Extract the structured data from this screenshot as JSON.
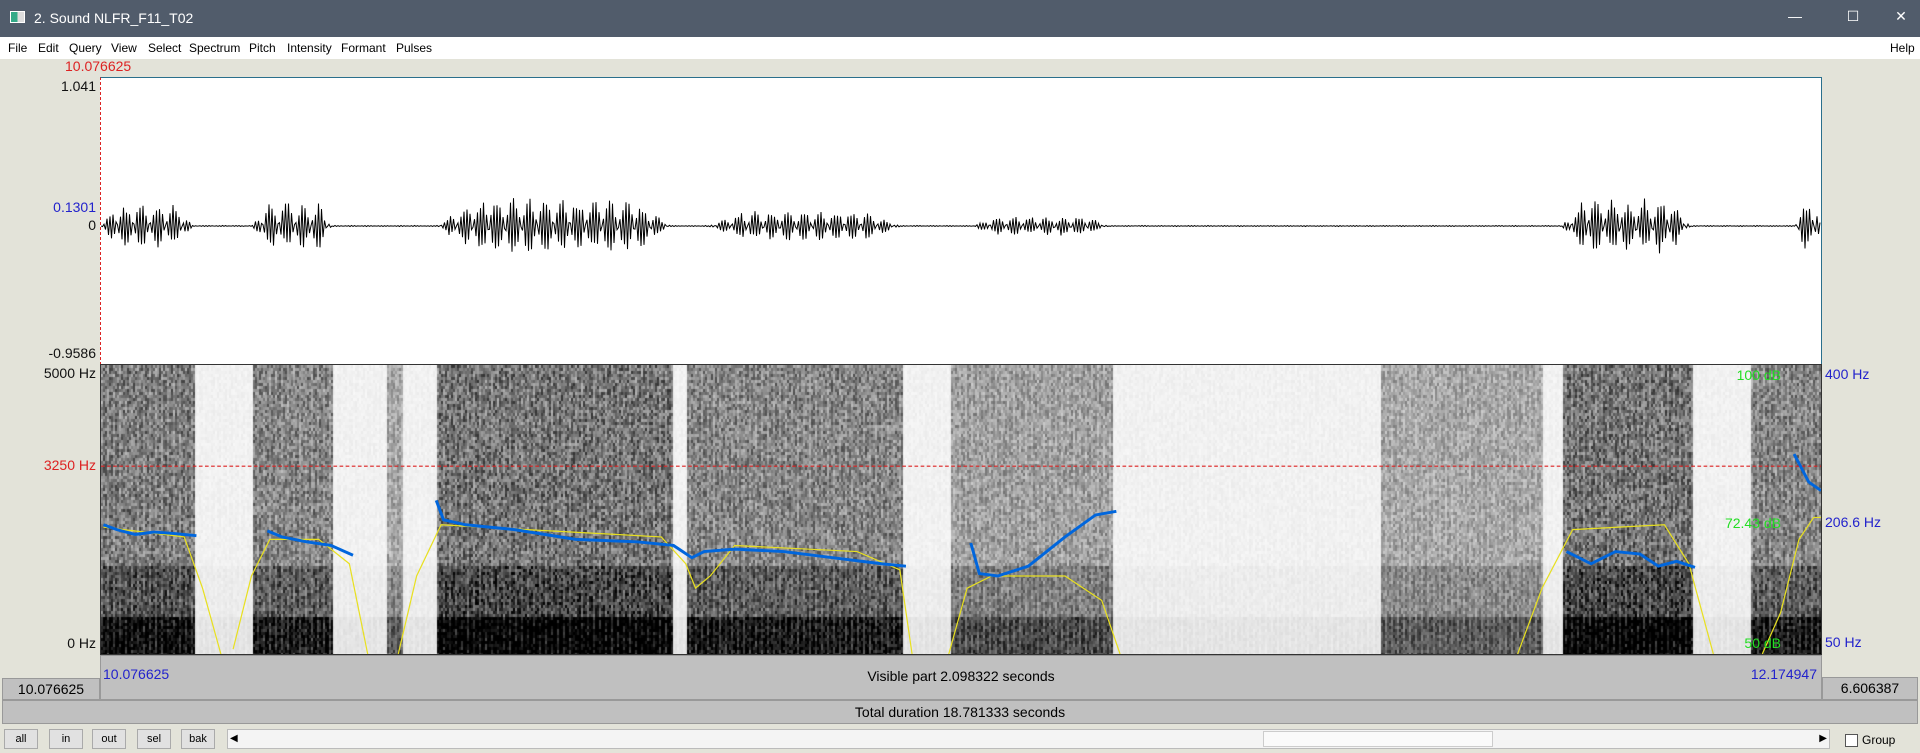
{
  "window": {
    "title": "2. Sound NLFR_F11_T02",
    "minimize": "—",
    "maximize": "☐",
    "close": "✕"
  },
  "menu": [
    "File",
    "Edit",
    "Query",
    "View",
    "Select",
    "Spectrum",
    "Pitch",
    "Intensity",
    "Formant",
    "Pulses"
  ],
  "menu_help": "Help",
  "cursor_time": "10.076625",
  "waveform": {
    "max": "1.041",
    "cursor_value": "0.1301",
    "zero": "0",
    "min": "-0.9586"
  },
  "spectrogram": {
    "top": "5000 Hz",
    "cursor": "3250 Hz",
    "bottom": "0 Hz",
    "right_top_db": "100 dB",
    "right_top_hz": "400 Hz",
    "right_mid_db": "72.43 dB",
    "right_mid_hz": "206.6 Hz",
    "right_bottom_db": "50 dB",
    "right_bottom_hz": "50 Hz"
  },
  "bottom": {
    "left_box": "10.076625",
    "visible_start": "10.076625",
    "visible_label": "Visible part 2.098322 seconds",
    "visible_end": "12.174947",
    "right_box": "6.606387",
    "total_label": "Total duration 18.781333 seconds"
  },
  "buttons": [
    "all",
    "in",
    "out",
    "sel",
    "bak"
  ],
  "group_label": "Group",
  "colors": {
    "pitch": "#0066dd",
    "intensity": "#e8e020",
    "cursor": "#dd2222"
  }
}
